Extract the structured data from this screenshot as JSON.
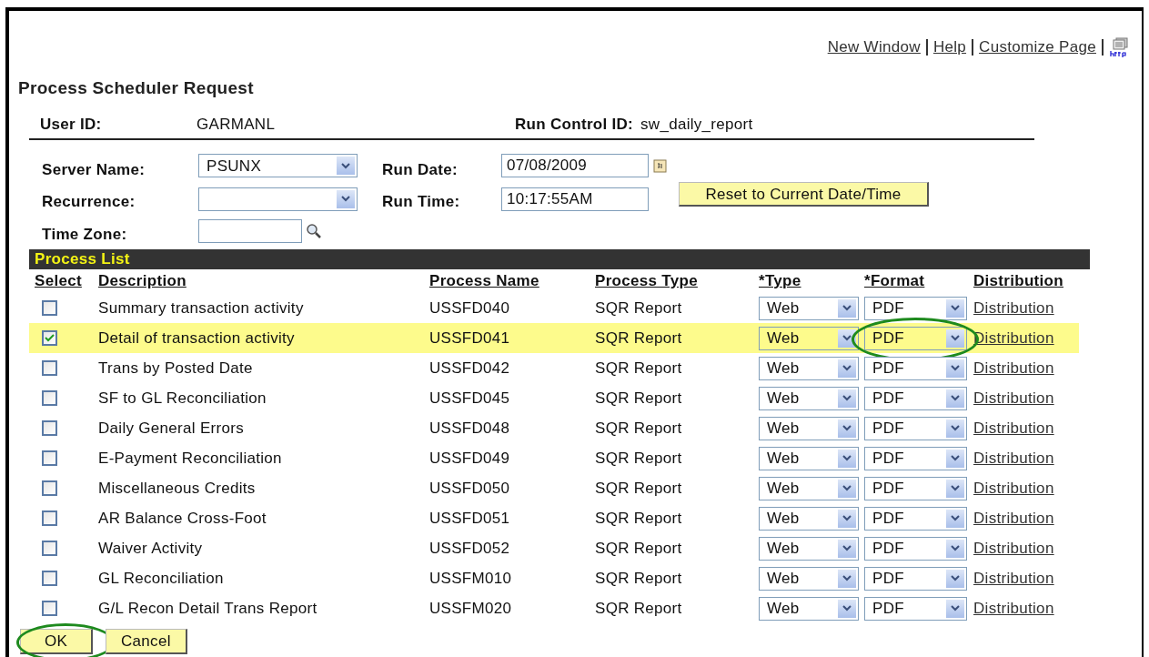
{
  "header_links": [
    {
      "label": "New Window"
    },
    {
      "label": "Help"
    },
    {
      "label": "Customize Page"
    }
  ],
  "title": "Process Scheduler Request",
  "user_id": {
    "label": "User ID:",
    "value": "GARMANL"
  },
  "run_control_id": {
    "label": "Run Control ID:",
    "value": "sw_daily_report"
  },
  "server_name": {
    "label": "Server Name:",
    "value": "PSUNX"
  },
  "recurrence": {
    "label": "Recurrence:"
  },
  "time_zone": {
    "label": "Time Zone:"
  },
  "run_date": {
    "label": "Run Date:",
    "value": "07/08/2009"
  },
  "run_time": {
    "label": "Run Time:",
    "value": "10:17:55AM"
  },
  "reset_button": "Reset to Current Date/Time",
  "process_list": {
    "title": "Process List",
    "columns": [
      "Select",
      "Description",
      "Process Name",
      "Process Type",
      "*Type",
      "*Format",
      "Distribution"
    ],
    "rows": [
      {
        "checked": false,
        "description": "Summary transaction activity",
        "process_name": "USSFD040",
        "process_type": "SQR Report",
        "type": "Web",
        "format": "PDF",
        "distribution": "Distribution",
        "format_circled": false
      },
      {
        "checked": true,
        "description": "Detail of transaction activity",
        "process_name": "USSFD041",
        "process_type": "SQR Report",
        "type": "Web",
        "format": "PDF",
        "distribution": "Distribution",
        "format_circled": true
      },
      {
        "checked": false,
        "description": "Trans by Posted Date",
        "process_name": "USSFD042",
        "process_type": "SQR Report",
        "type": "Web",
        "format": "PDF",
        "distribution": "Distribution",
        "format_circled": false
      },
      {
        "checked": false,
        "description": "SF to GL Reconciliation",
        "process_name": "USSFD045",
        "process_type": "SQR Report",
        "type": "Web",
        "format": "PDF",
        "distribution": "Distribution",
        "format_circled": false
      },
      {
        "checked": false,
        "description": "Daily General Errors",
        "process_name": "USSFD048",
        "process_type": "SQR Report",
        "type": "Web",
        "format": "PDF",
        "distribution": "Distribution",
        "format_circled": false
      },
      {
        "checked": false,
        "description": "E-Payment Reconciliation",
        "process_name": "USSFD049",
        "process_type": "SQR Report",
        "type": "Web",
        "format": "PDF",
        "distribution": "Distribution",
        "format_circled": false
      },
      {
        "checked": false,
        "description": "Miscellaneous Credits",
        "process_name": "USSFD050",
        "process_type": "SQR Report",
        "type": "Web",
        "format": "PDF",
        "distribution": "Distribution",
        "format_circled": false
      },
      {
        "checked": false,
        "description": "AR Balance Cross-Foot",
        "process_name": "USSFD051",
        "process_type": "SQR Report",
        "type": "Web",
        "format": "PDF",
        "distribution": "Distribution",
        "format_circled": false
      },
      {
        "checked": false,
        "description": "Waiver Activity",
        "process_name": "USSFD052",
        "process_type": "SQR Report",
        "type": "Web",
        "format": "PDF",
        "distribution": "Distribution",
        "format_circled": false
      },
      {
        "checked": false,
        "description": "GL Reconciliation",
        "process_name": "USSFM010",
        "process_type": "SQR Report",
        "type": "Web",
        "format": "PDF",
        "distribution": "Distribution",
        "format_circled": false
      },
      {
        "checked": false,
        "description": "G/L Recon Detail Trans Report",
        "process_name": "USSFM020",
        "process_type": "SQR Report",
        "type": "Web",
        "format": "PDF",
        "distribution": "Distribution",
        "format_circled": false
      }
    ]
  },
  "buttons": [
    {
      "label": "OK",
      "circled": true
    },
    {
      "label": "Cancel",
      "circled": false
    }
  ]
}
